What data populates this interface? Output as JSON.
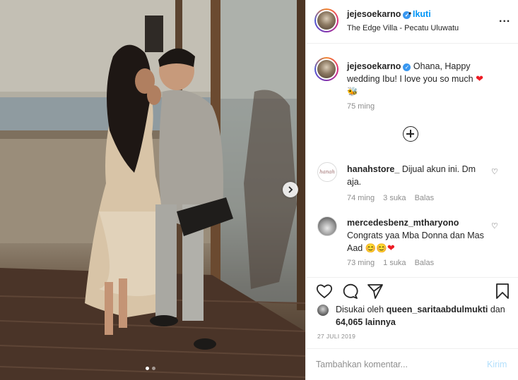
{
  "header": {
    "username": "jejesoekarno",
    "follow_label": "Ikuti",
    "follow_separator": "•",
    "location": "The Edge Villa - Pecatu Uluwatu",
    "more_label": "..."
  },
  "caption": {
    "username": "jejesoekarno",
    "text_1": "Ohana, Happy wedding Ibu! I love you so much",
    "heart_emoji": "❤",
    "bee_emoji": "🐝",
    "time": "75 ming"
  },
  "comments": [
    {
      "username": "hanahstore_",
      "text": "Dijual akun ini. Dm aja.",
      "avatar_text": "hanah",
      "time": "74 ming",
      "likes": "3 suka",
      "reply": "Balas"
    },
    {
      "username": "mercedesbenz_mtharyono",
      "text": "Congrats yaa Mba Donna dan Mas Aad",
      "emojis": "😊😊",
      "heart_emoji": "❤",
      "time": "73 ming",
      "likes": "1 suka",
      "reply": "Balas"
    }
  ],
  "likes": {
    "prefix": "Disukai oleh",
    "liker": "queen_saritaabdulmukti",
    "conjunction": "dan",
    "count": "64,065 lainnya"
  },
  "date": "27 JULI 2019",
  "add_comment": {
    "placeholder": "Tambahkan komentar...",
    "post_label": "Kirim"
  },
  "carousel": {
    "current": 1,
    "total": 2
  },
  "icons": [
    "heart-icon",
    "comment-icon",
    "share-icon",
    "bookmark-icon",
    "chevron-right-icon",
    "add-circle-icon",
    "verified-icon",
    "more-icon"
  ],
  "colors": {
    "link": "#0095f6",
    "verified": "#3897f0",
    "muted": "#8e8e8e",
    "border": "#efefef",
    "post_disabled": "#b2dffc"
  }
}
